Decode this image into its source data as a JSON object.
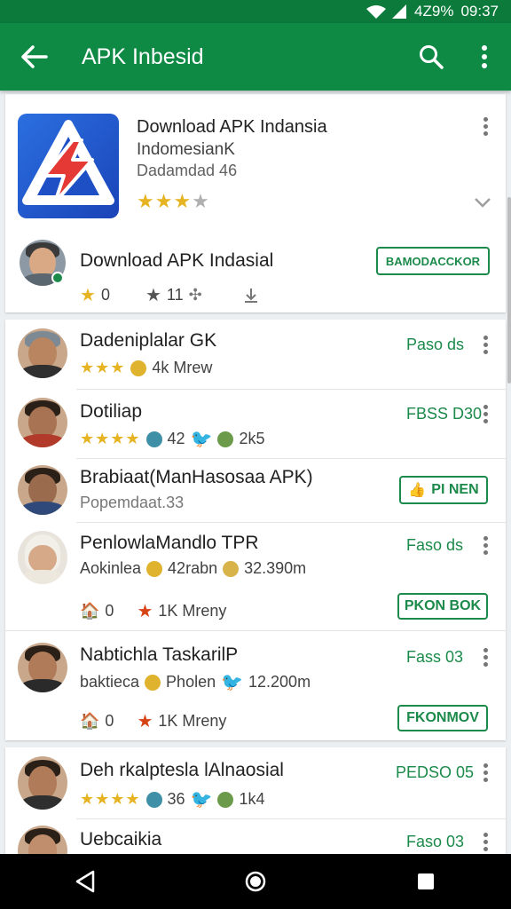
{
  "status_bar": {
    "battery": "4Z9%",
    "time": "09:37"
  },
  "app_bar": {
    "title": "APK Inbesid"
  },
  "hero": {
    "title": "Download APK Indansia",
    "subtitle": "IndomesianK",
    "downloads": "Dadamdad 46",
    "rating_stars": "★★★",
    "rating_off": "★"
  },
  "featured_user": {
    "name": "Download APK Indasial",
    "button": "BAMODACCKOR",
    "likes": "0",
    "stars_count": "11"
  },
  "list_group_1": [
    {
      "title": "Dadeniplalar GK",
      "meta_stars": "★★★",
      "meta_text": "4k Mrew",
      "price": "Paso ds"
    },
    {
      "title": "Dotiliap",
      "meta_stars": "★★★★",
      "meta_a": "42",
      "meta_b": "2k5",
      "price": "FBSS D30"
    },
    {
      "title": "Brabiaat(ManHasosaa APK)",
      "meta_text": "Popemdaat.33",
      "button": "PI NEN"
    },
    {
      "title": "PenlowlaMandlo TPR",
      "meta_a": "Aokinlea",
      "meta_b": "42rabn",
      "meta_c": "32.390m",
      "price": "Faso ds",
      "action_a": "0",
      "action_b": "1K Mreny",
      "button": "PKON BOK"
    },
    {
      "title": "Nabtichla TaskarilP",
      "meta_a": "baktieca",
      "meta_b": "Pholen",
      "meta_c": "12.200m",
      "price": "Fass 03",
      "action_a": "0",
      "action_b": "1K Mreny",
      "button": "FKONMOV"
    }
  ],
  "list_group_2": [
    {
      "title": "Deh rkalptesla lAlnaosial",
      "meta_stars": "★★★★",
      "meta_a": "36",
      "meta_b": "1k4",
      "price": "PEDSO 05"
    },
    {
      "title": "Uebcaikia",
      "price": "Faso 03"
    }
  ]
}
